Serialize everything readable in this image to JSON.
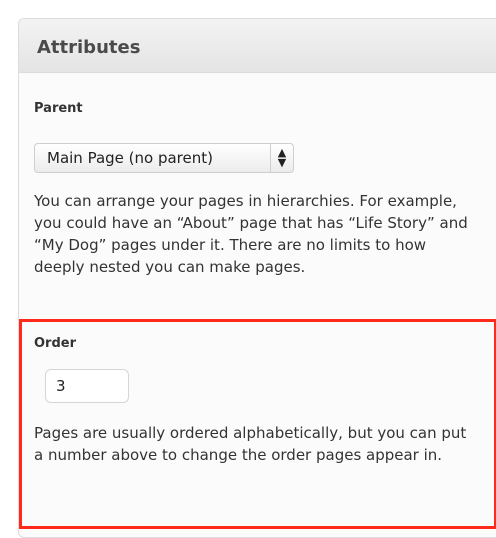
{
  "panel": {
    "title": "Attributes"
  },
  "parent": {
    "label": "Parent",
    "selected": "Main Page (no parent)",
    "description": "You can arrange your pages in hierarchies. For example, you could have an “About” page that has “Life Story” and “My Dog” pages under it. There are no limits to how deeply nested you can make pages."
  },
  "order": {
    "label": "Order",
    "value": "3",
    "description": "Pages are usually ordered alphabetically, but you can put a number above to change the order pages appear in."
  },
  "colors": {
    "highlight_border": "#ff2a1a"
  },
  "icons": {
    "select_arrows": "up-down-arrows-icon"
  }
}
